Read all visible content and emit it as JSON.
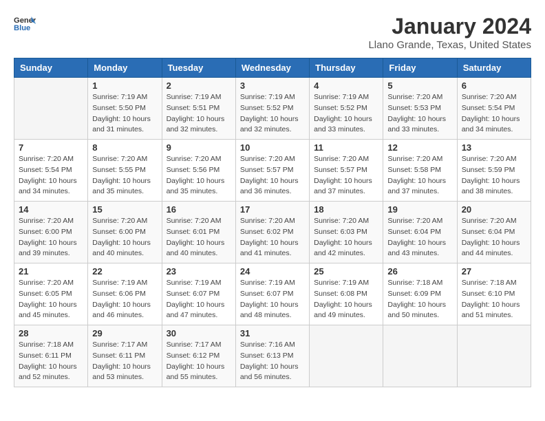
{
  "header": {
    "logo_line1": "General",
    "logo_line2": "Blue",
    "month": "January 2024",
    "location": "Llano Grande, Texas, United States"
  },
  "weekdays": [
    "Sunday",
    "Monday",
    "Tuesday",
    "Wednesday",
    "Thursday",
    "Friday",
    "Saturday"
  ],
  "weeks": [
    [
      {
        "day": "",
        "sunrise": "",
        "sunset": "",
        "daylight": ""
      },
      {
        "day": "1",
        "sunrise": "Sunrise: 7:19 AM",
        "sunset": "Sunset: 5:50 PM",
        "daylight": "Daylight: 10 hours and 31 minutes."
      },
      {
        "day": "2",
        "sunrise": "Sunrise: 7:19 AM",
        "sunset": "Sunset: 5:51 PM",
        "daylight": "Daylight: 10 hours and 32 minutes."
      },
      {
        "day": "3",
        "sunrise": "Sunrise: 7:19 AM",
        "sunset": "Sunset: 5:52 PM",
        "daylight": "Daylight: 10 hours and 32 minutes."
      },
      {
        "day": "4",
        "sunrise": "Sunrise: 7:19 AM",
        "sunset": "Sunset: 5:52 PM",
        "daylight": "Daylight: 10 hours and 33 minutes."
      },
      {
        "day": "5",
        "sunrise": "Sunrise: 7:20 AM",
        "sunset": "Sunset: 5:53 PM",
        "daylight": "Daylight: 10 hours and 33 minutes."
      },
      {
        "day": "6",
        "sunrise": "Sunrise: 7:20 AM",
        "sunset": "Sunset: 5:54 PM",
        "daylight": "Daylight: 10 hours and 34 minutes."
      }
    ],
    [
      {
        "day": "7",
        "sunrise": "Sunrise: 7:20 AM",
        "sunset": "Sunset: 5:54 PM",
        "daylight": "Daylight: 10 hours and 34 minutes."
      },
      {
        "day": "8",
        "sunrise": "Sunrise: 7:20 AM",
        "sunset": "Sunset: 5:55 PM",
        "daylight": "Daylight: 10 hours and 35 minutes."
      },
      {
        "day": "9",
        "sunrise": "Sunrise: 7:20 AM",
        "sunset": "Sunset: 5:56 PM",
        "daylight": "Daylight: 10 hours and 35 minutes."
      },
      {
        "day": "10",
        "sunrise": "Sunrise: 7:20 AM",
        "sunset": "Sunset: 5:57 PM",
        "daylight": "Daylight: 10 hours and 36 minutes."
      },
      {
        "day": "11",
        "sunrise": "Sunrise: 7:20 AM",
        "sunset": "Sunset: 5:57 PM",
        "daylight": "Daylight: 10 hours and 37 minutes."
      },
      {
        "day": "12",
        "sunrise": "Sunrise: 7:20 AM",
        "sunset": "Sunset: 5:58 PM",
        "daylight": "Daylight: 10 hours and 37 minutes."
      },
      {
        "day": "13",
        "sunrise": "Sunrise: 7:20 AM",
        "sunset": "Sunset: 5:59 PM",
        "daylight": "Daylight: 10 hours and 38 minutes."
      }
    ],
    [
      {
        "day": "14",
        "sunrise": "Sunrise: 7:20 AM",
        "sunset": "Sunset: 6:00 PM",
        "daylight": "Daylight: 10 hours and 39 minutes."
      },
      {
        "day": "15",
        "sunrise": "Sunrise: 7:20 AM",
        "sunset": "Sunset: 6:00 PM",
        "daylight": "Daylight: 10 hours and 40 minutes."
      },
      {
        "day": "16",
        "sunrise": "Sunrise: 7:20 AM",
        "sunset": "Sunset: 6:01 PM",
        "daylight": "Daylight: 10 hours and 40 minutes."
      },
      {
        "day": "17",
        "sunrise": "Sunrise: 7:20 AM",
        "sunset": "Sunset: 6:02 PM",
        "daylight": "Daylight: 10 hours and 41 minutes."
      },
      {
        "day": "18",
        "sunrise": "Sunrise: 7:20 AM",
        "sunset": "Sunset: 6:03 PM",
        "daylight": "Daylight: 10 hours and 42 minutes."
      },
      {
        "day": "19",
        "sunrise": "Sunrise: 7:20 AM",
        "sunset": "Sunset: 6:04 PM",
        "daylight": "Daylight: 10 hours and 43 minutes."
      },
      {
        "day": "20",
        "sunrise": "Sunrise: 7:20 AM",
        "sunset": "Sunset: 6:04 PM",
        "daylight": "Daylight: 10 hours and 44 minutes."
      }
    ],
    [
      {
        "day": "21",
        "sunrise": "Sunrise: 7:20 AM",
        "sunset": "Sunset: 6:05 PM",
        "daylight": "Daylight: 10 hours and 45 minutes."
      },
      {
        "day": "22",
        "sunrise": "Sunrise: 7:19 AM",
        "sunset": "Sunset: 6:06 PM",
        "daylight": "Daylight: 10 hours and 46 minutes."
      },
      {
        "day": "23",
        "sunrise": "Sunrise: 7:19 AM",
        "sunset": "Sunset: 6:07 PM",
        "daylight": "Daylight: 10 hours and 47 minutes."
      },
      {
        "day": "24",
        "sunrise": "Sunrise: 7:19 AM",
        "sunset": "Sunset: 6:07 PM",
        "daylight": "Daylight: 10 hours and 48 minutes."
      },
      {
        "day": "25",
        "sunrise": "Sunrise: 7:19 AM",
        "sunset": "Sunset: 6:08 PM",
        "daylight": "Daylight: 10 hours and 49 minutes."
      },
      {
        "day": "26",
        "sunrise": "Sunrise: 7:18 AM",
        "sunset": "Sunset: 6:09 PM",
        "daylight": "Daylight: 10 hours and 50 minutes."
      },
      {
        "day": "27",
        "sunrise": "Sunrise: 7:18 AM",
        "sunset": "Sunset: 6:10 PM",
        "daylight": "Daylight: 10 hours and 51 minutes."
      }
    ],
    [
      {
        "day": "28",
        "sunrise": "Sunrise: 7:18 AM",
        "sunset": "Sunset: 6:11 PM",
        "daylight": "Daylight: 10 hours and 52 minutes."
      },
      {
        "day": "29",
        "sunrise": "Sunrise: 7:17 AM",
        "sunset": "Sunset: 6:11 PM",
        "daylight": "Daylight: 10 hours and 53 minutes."
      },
      {
        "day": "30",
        "sunrise": "Sunrise: 7:17 AM",
        "sunset": "Sunset: 6:12 PM",
        "daylight": "Daylight: 10 hours and 55 minutes."
      },
      {
        "day": "31",
        "sunrise": "Sunrise: 7:16 AM",
        "sunset": "Sunset: 6:13 PM",
        "daylight": "Daylight: 10 hours and 56 minutes."
      },
      {
        "day": "",
        "sunrise": "",
        "sunset": "",
        "daylight": ""
      },
      {
        "day": "",
        "sunrise": "",
        "sunset": "",
        "daylight": ""
      },
      {
        "day": "",
        "sunrise": "",
        "sunset": "",
        "daylight": ""
      }
    ]
  ]
}
